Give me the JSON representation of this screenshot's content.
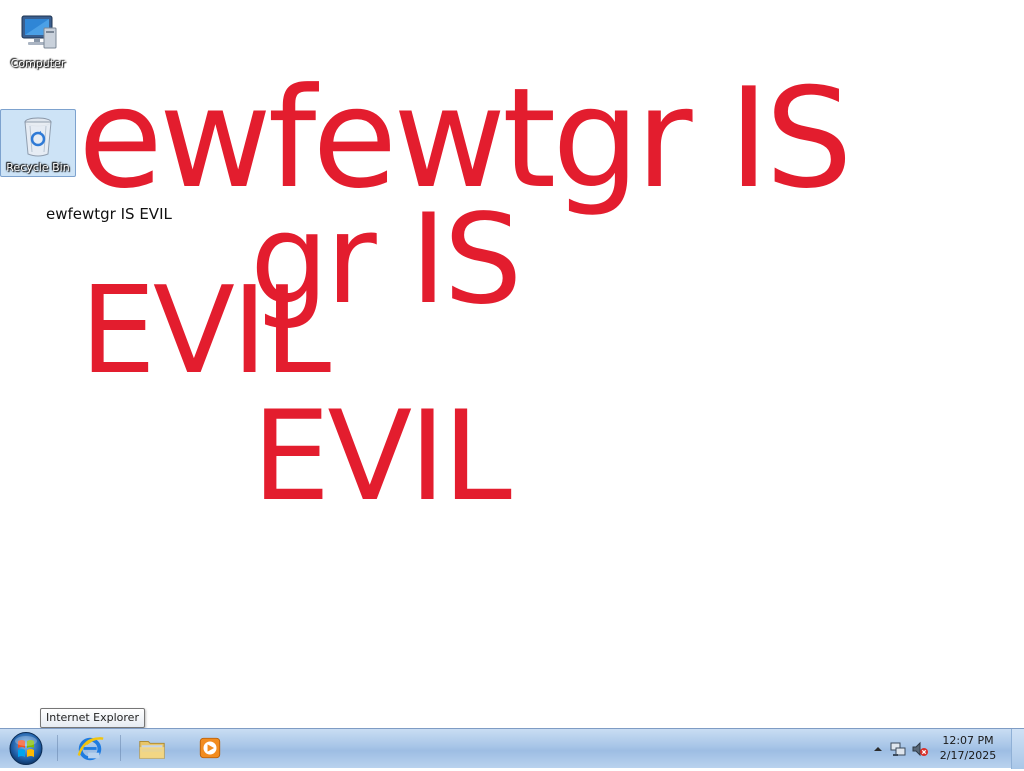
{
  "desktop": {
    "icons": [
      {
        "label": "Computer",
        "icon": "computer-icon"
      },
      {
        "label": "Recycle Bin",
        "icon": "recycle-bin-icon"
      }
    ],
    "overlay_lines": [
      "ewfewtgr IS",
      "EVIL",
      "gr IS",
      "EVIL"
    ],
    "note_text": "ewfewtgr IS EVIL"
  },
  "tooltip": {
    "text": "Internet Explorer"
  },
  "taskbar": {
    "start": "start-orb-icon",
    "pinned": [
      {
        "name": "Internet Explorer",
        "icon": "internet-explorer-icon"
      },
      {
        "name": "Windows Explorer",
        "icon": "folder-icon"
      },
      {
        "name": "Windows Media Player",
        "icon": "media-player-icon"
      }
    ],
    "tray": {
      "icons": [
        "show-hidden-icons-icon",
        "network-icon",
        "volume-muted-icon"
      ],
      "time": "12:07 PM",
      "date": "2/17/2025"
    }
  },
  "colors": {
    "overlay_red": "#e31d2e",
    "taskbar_blue": "#a7c5e7"
  }
}
